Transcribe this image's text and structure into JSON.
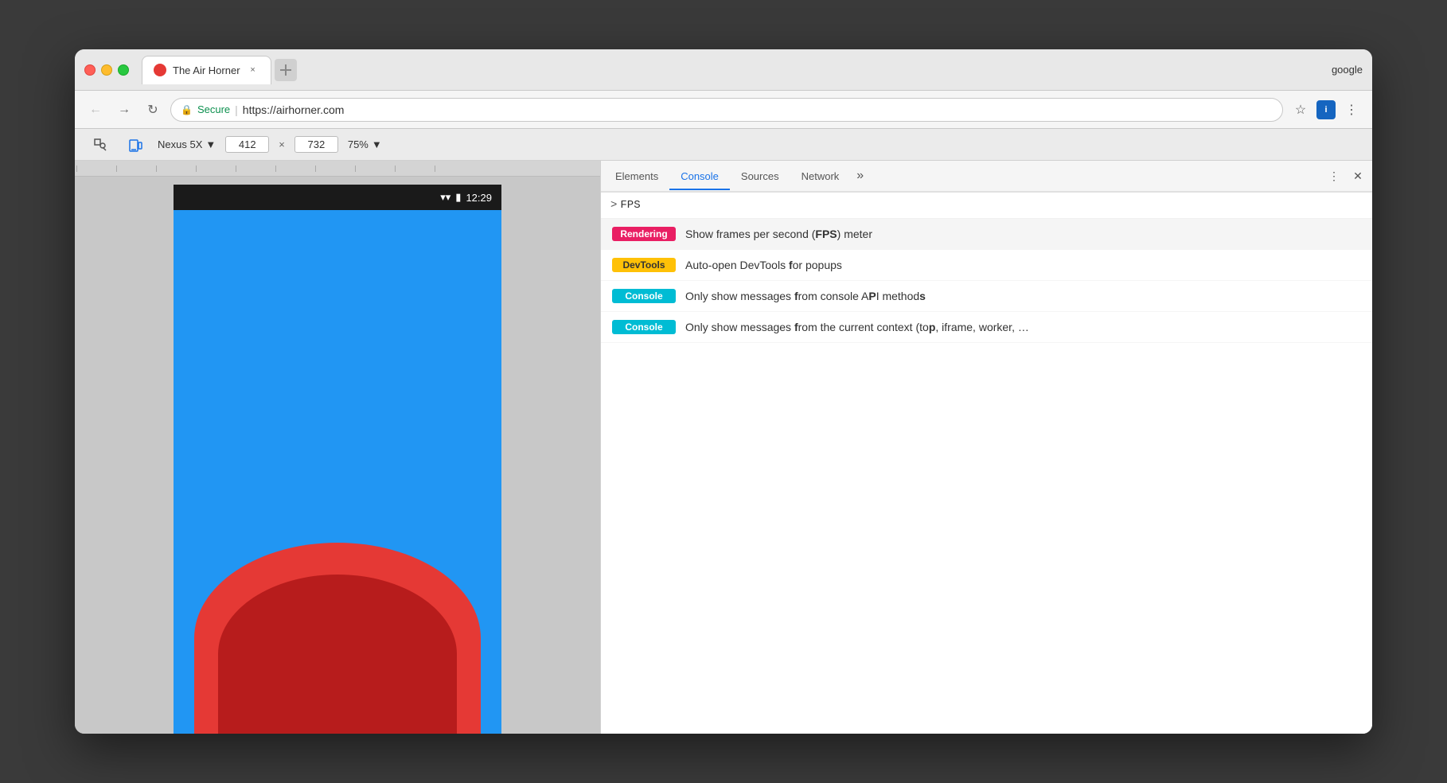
{
  "browser": {
    "title": "The Air Horner",
    "tab_close": "×",
    "google_text": "google",
    "traffic_lights": {
      "close": "close",
      "minimize": "minimize",
      "maximize": "maximize"
    }
  },
  "toolbar": {
    "secure_label": "Secure",
    "url": "https://airhorner.com",
    "separator": "|",
    "star": "☆",
    "menu": "⋮"
  },
  "device_toolbar": {
    "device": "Nexus 5X",
    "width": "412",
    "x": "×",
    "height": "732",
    "zoom": "75%"
  },
  "phone": {
    "time": "12:29"
  },
  "devtools": {
    "tabs": {
      "elements": "Elements",
      "console": "Console",
      "sources": "Sources",
      "network": "Network",
      "more": "»"
    },
    "console_input": ">FPS",
    "prompt": ">"
  },
  "autocomplete": {
    "items": [
      {
        "badge": "Rendering",
        "badge_class": "badge-rendering",
        "text_before": "Show frames per second (",
        "text_bold": "FPS",
        "text_after": ") meter"
      },
      {
        "badge": "DevTools",
        "badge_class": "badge-devtools",
        "text_before": "Auto-open DevTools ",
        "text_bold_parts": [
          [
            "f",
            "or popups"
          ]
        ],
        "text_display": "Auto-open DevTools for popups"
      },
      {
        "badge": "Console",
        "badge_class": "badge-console",
        "text_before": "Only show messages ",
        "text_display": "Only show messages from console API methods"
      },
      {
        "badge": "Console",
        "badge_class": "badge-console",
        "text_before": "Only show messages ",
        "text_display": "Only show messages from the current context (top, iframe, worker, …"
      }
    ]
  }
}
